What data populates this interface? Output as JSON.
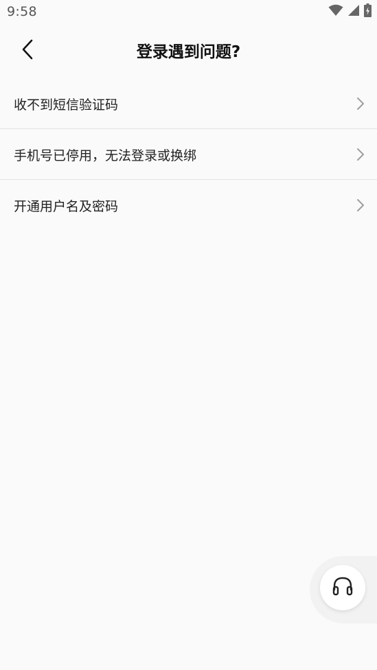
{
  "status_bar": {
    "time": "9:58",
    "icons": [
      "wifi-icon",
      "cell-signal-icon",
      "battery-charging-icon"
    ]
  },
  "header": {
    "back_icon": "chevron-left-icon",
    "title": "登录遇到问题?"
  },
  "list": {
    "items": [
      {
        "label": "收不到短信验证码"
      },
      {
        "label": "手机号已停用，无法登录或换绑"
      },
      {
        "label": "开通用户名及密码"
      }
    ],
    "item_icon": "chevron-right-icon"
  },
  "support": {
    "icon": "headphones-icon"
  },
  "colors": {
    "background": "#fafafa",
    "text": "#222222",
    "divider": "#e4e4e4",
    "chevron": "#9e9e9e"
  }
}
